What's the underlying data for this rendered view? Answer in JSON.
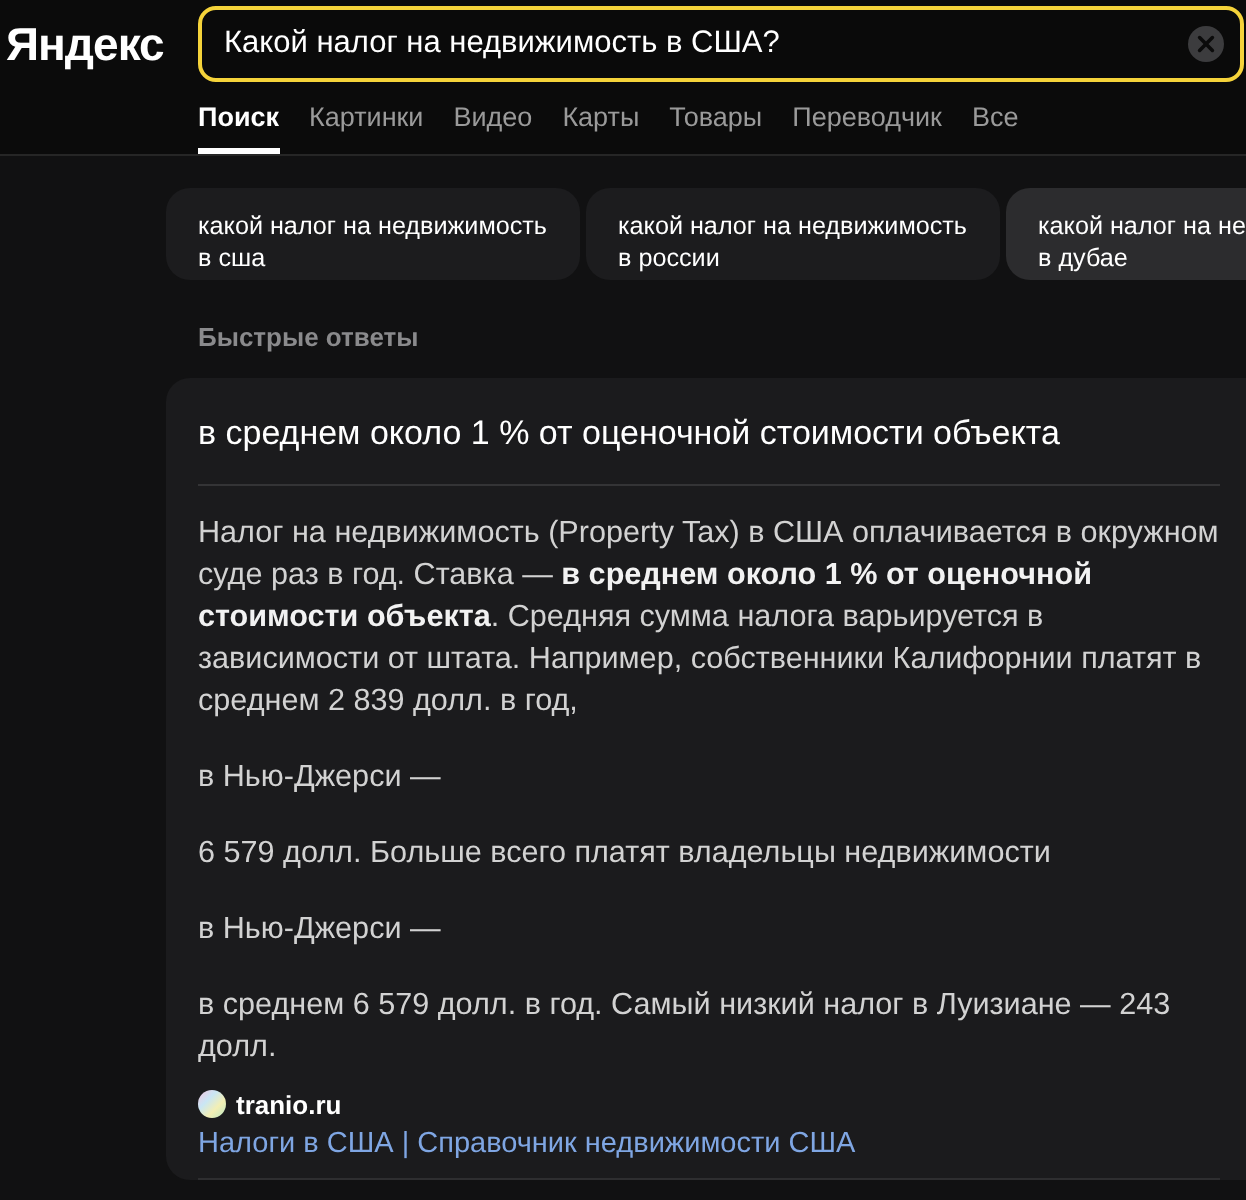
{
  "header": {
    "logo": "Яндекс",
    "search": {
      "value": "Какой налог на недвижимость в США?",
      "focused": true
    }
  },
  "tabs": [
    {
      "label": "Поиск",
      "selected": true
    },
    {
      "label": "Картинки",
      "selected": false
    },
    {
      "label": "Видео",
      "selected": false
    },
    {
      "label": "Карты",
      "selected": false
    },
    {
      "label": "Товары",
      "selected": false
    },
    {
      "label": "Переводчик",
      "selected": false
    },
    {
      "label": "Все",
      "selected": false
    }
  ],
  "suggestions": [
    {
      "lines": [
        "какой налог на недвижимость",
        "в сша"
      ],
      "highlighted": false
    },
    {
      "lines": [
        "какой налог на недвижимость",
        "в россии"
      ],
      "highlighted": false
    },
    {
      "lines": [
        "какой налог на не",
        "в дубае"
      ],
      "highlighted": true
    }
  ],
  "quick_answers": {
    "heading": "Быстрые ответы",
    "answer": {
      "title": "в среднем около 1 % от оценочной стоимости объекта",
      "paragraphs": [
        "Налог на недвижимость (Property Tax) в США оплачивается в окружном суде раз в год. Ставка — **в среднем около 1 % от оценочной стоимости объекта**. Средняя сумма налога варьируется в зависимости от штата. Например, собственники Калифорнии платят в среднем 2 839 долл. в год,",
        "в Нью-Джерси —",
        "6 579 долл. Больше всего платят владельцы недвижимости",
        "в Нью-Джерси —",
        "в среднем 6 579 долл. в год. Самый низкий налог в Луизиане — 243 долл."
      ],
      "source": {
        "domain": "tranio.ru",
        "link": "Налоги в США | Справочник недвижимости США"
      }
    }
  }
}
